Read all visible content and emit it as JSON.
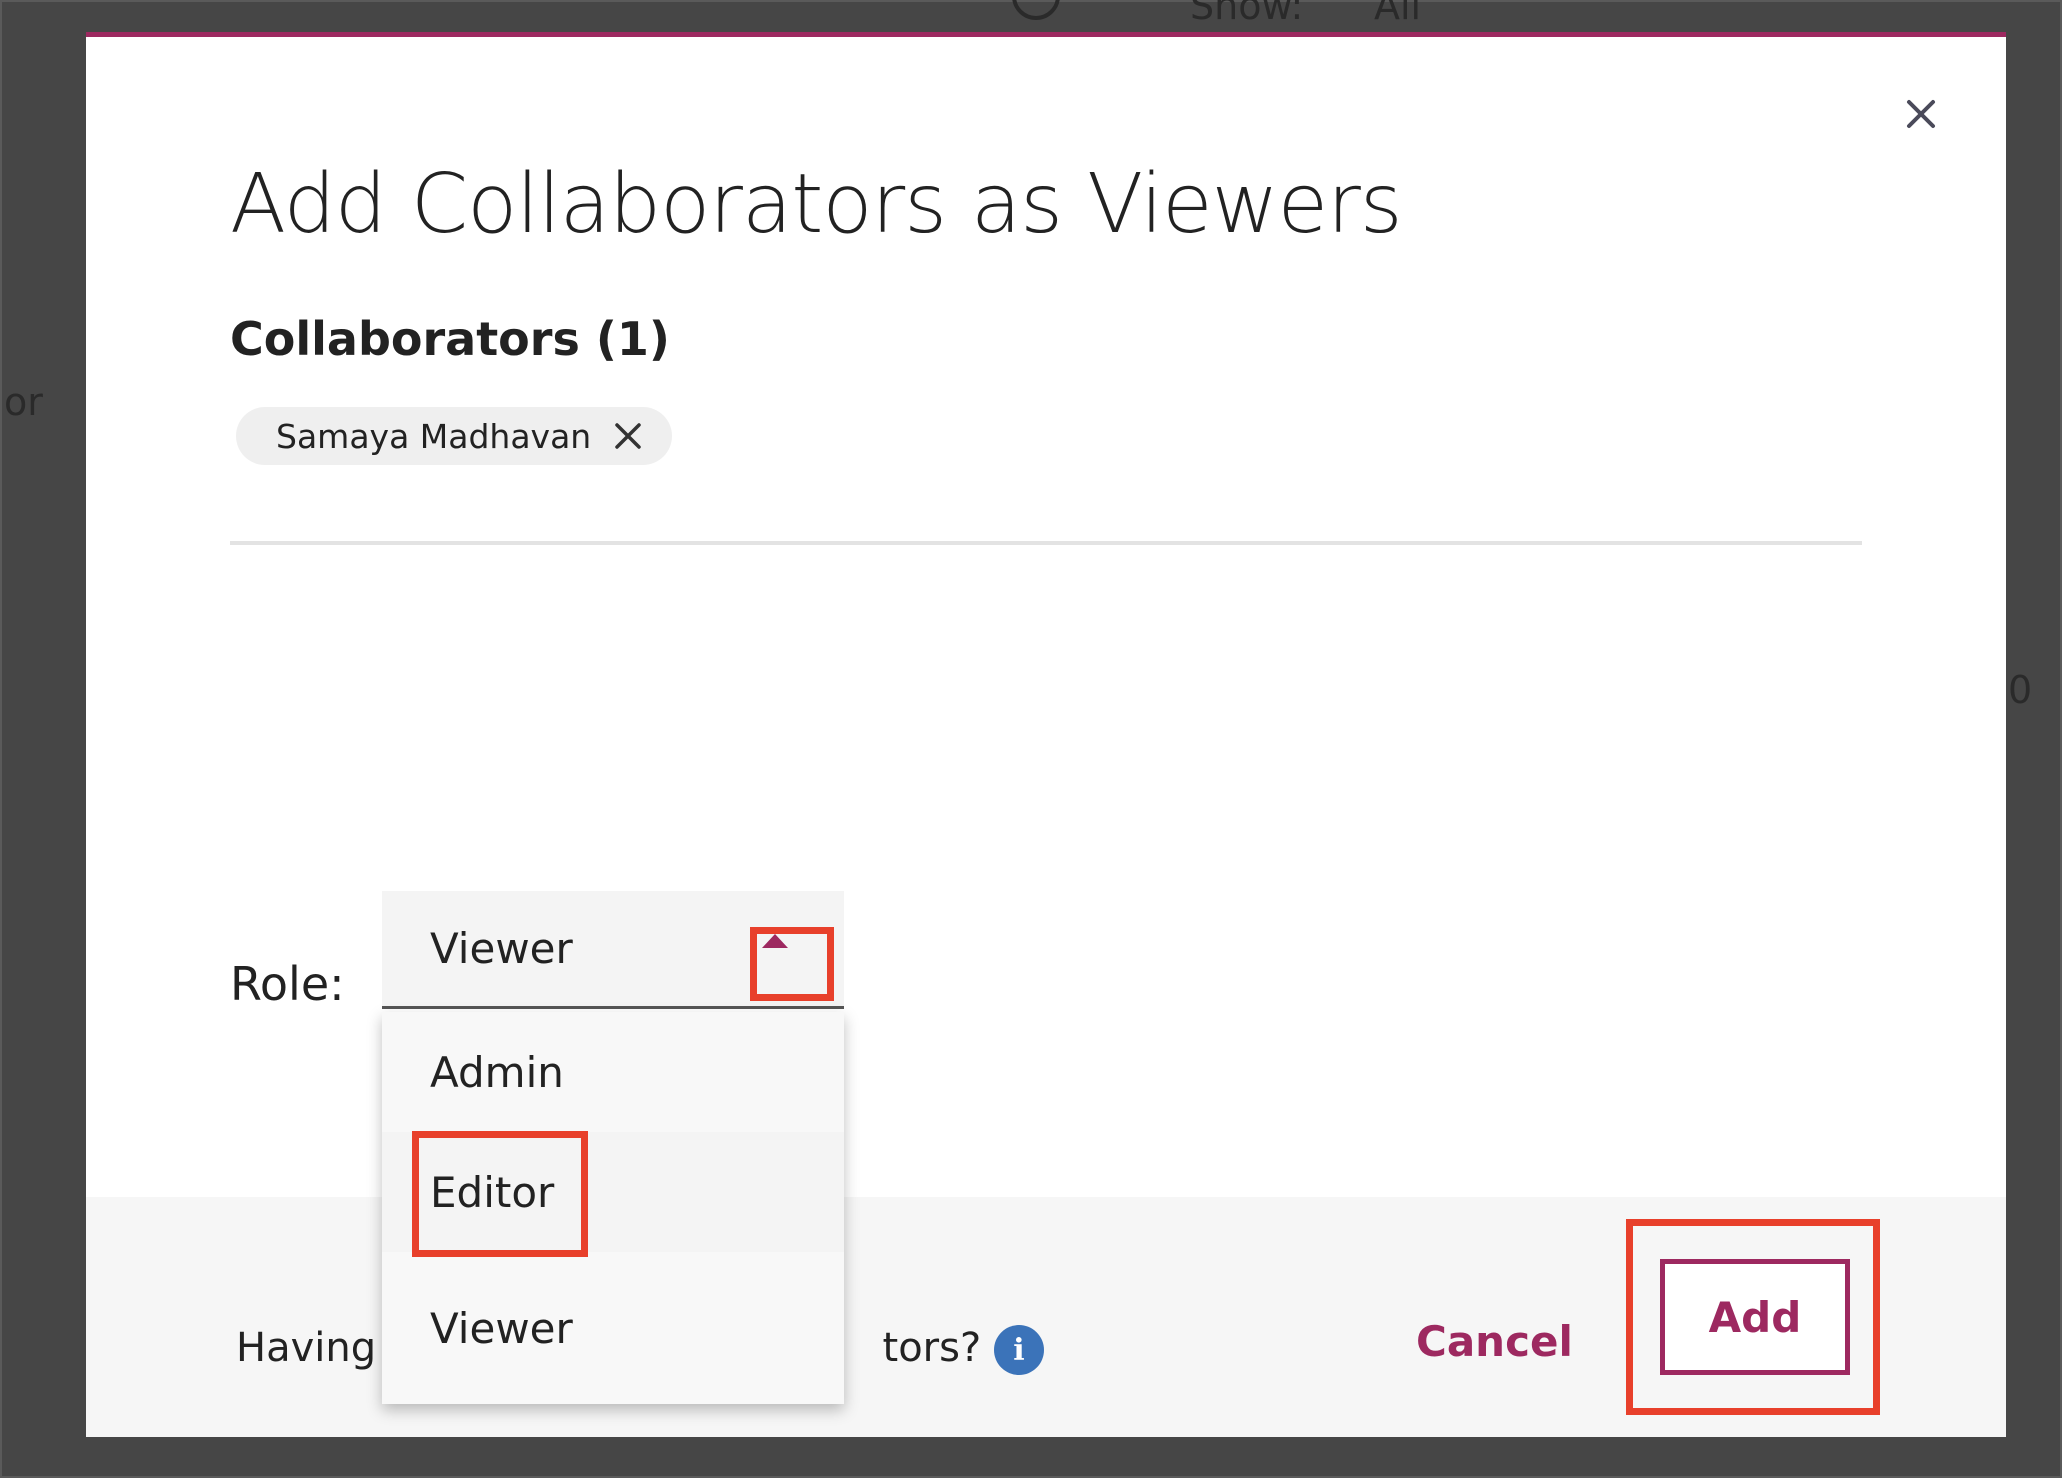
{
  "background": {
    "show_label": "Show:",
    "filter_value": "All",
    "side_text": "or",
    "right_text": "0"
  },
  "modal": {
    "title": "Add Collaborators as Viewers",
    "collaborators_label": "Collaborators (1)",
    "chips": [
      {
        "name": "Samaya Madhavan"
      }
    ],
    "role_label": "Role:",
    "role_selected": "Viewer",
    "role_options": [
      "Admin",
      "Editor",
      "Viewer"
    ],
    "help_text_left": "Having t",
    "help_text_right": "tors?",
    "cancel_label": "Cancel",
    "add_label": "Add"
  },
  "colors": {
    "accent": "#9d2960",
    "highlight": "#e8402b",
    "info": "#3b73b9"
  },
  "icons": {
    "close": "close-icon",
    "chip_remove": "close-icon",
    "caret": "caret-up-icon",
    "info": "info-icon",
    "search": "search-icon"
  }
}
